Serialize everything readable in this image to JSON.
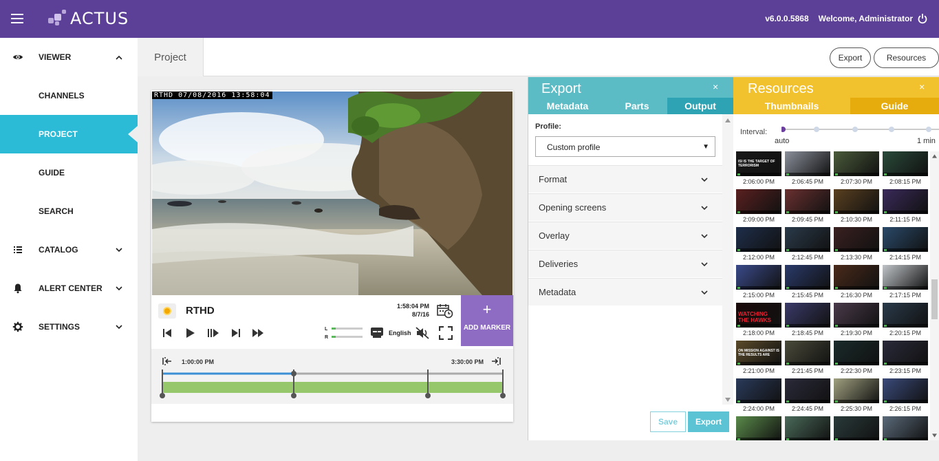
{
  "topbar": {
    "brand": "ACTUS",
    "version": "v6.0.0.5868",
    "welcome": "Welcome, Administrator"
  },
  "sidebar": {
    "items": [
      {
        "label": "VIEWER",
        "icon": "eye-icon",
        "chevron": "up"
      },
      {
        "label": "CHANNELS"
      },
      {
        "label": "PROJECT",
        "active": true
      },
      {
        "label": "GUIDE"
      },
      {
        "label": "SEARCH"
      },
      {
        "label": "CATALOG",
        "icon": "list-icon",
        "chevron": "down"
      },
      {
        "label": "ALERT CENTER",
        "icon": "bell-icon",
        "chevron": "down"
      },
      {
        "label": "SETTINGS",
        "icon": "gear-icon",
        "chevron": "down"
      }
    ]
  },
  "header": {
    "tab": "Project",
    "export_label": "Export",
    "resources_label": "Resources"
  },
  "player": {
    "osd": "RTHD 07/08/2016 13:58:04",
    "channel": "RTHD",
    "time": "1:58:04 PM",
    "date": "8/7/16",
    "language": "English",
    "add_marker_plus": "+",
    "add_marker": "ADD MARKER",
    "audio_left": "L",
    "audio_right": "R",
    "timeline_start": "1:00:00 PM",
    "timeline_end": "3:30:00 PM"
  },
  "export_panel": {
    "title": "Export",
    "close": "×",
    "tabs": [
      "Metadata",
      "Parts",
      "Output"
    ],
    "active_tab": "Output",
    "profile_label": "Profile:",
    "profile_value": "Custom profile",
    "sections": [
      "Format",
      "Opening screens",
      "Overlay",
      "Deliveries",
      "Metadata"
    ],
    "save_label": "Save",
    "export_label": "Export"
  },
  "resources_panel": {
    "title": "Resources",
    "close": "×",
    "tabs": [
      "Thumbnails",
      "Guide"
    ],
    "active_tab": "Thumbnails",
    "interval_label": "Interval:",
    "interval_min": "auto",
    "interval_max": "1 min",
    "thumbnail_times": [
      "2:06:00 PM",
      "2:06:45 PM",
      "2:07:30 PM",
      "2:08:15 PM",
      "2:09:00 PM",
      "2:09:45 PM",
      "2:10:30 PM",
      "2:11:15 PM",
      "2:12:00 PM",
      "2:12:45 PM",
      "2:13:30 PM",
      "2:14:15 PM",
      "2:15:00 PM",
      "2:15:45 PM",
      "2:16:30 PM",
      "2:17:15 PM",
      "2:18:00 PM",
      "2:18:45 PM",
      "2:19:30 PM",
      "2:20:15 PM",
      "2:21:00 PM",
      "2:21:45 PM",
      "2:22:30 PM",
      "2:23:15 PM",
      "2:24:00 PM",
      "2:24:45 PM",
      "2:25:30 PM",
      "2:26:15 PM"
    ],
    "thumbnail_colors": [
      "#181818",
      "#8a8f9a",
      "#4a5a3a",
      "#2a4a3a",
      "#5a2020",
      "#6a3030",
      "#5a4020",
      "#3a2a5a",
      "#1e2e4a",
      "#2a3a4a",
      "#3a2020",
      "#2a4a6a",
      "#3a4a8a",
      "#2a3a6a",
      "#4a2a1a",
      "#c0c4c8",
      "#1a0a0a",
      "#3a3a6a",
      "#4a3a4a",
      "#2a3a4a",
      "#5a4a2a",
      "#4a4a3a",
      "#1a2a2a",
      "#2a2a3a",
      "#2a3a5a",
      "#2a2a3a",
      "#a0a080",
      "#3a4a7a",
      "#5a8a4a",
      "#4a6a5a",
      "#2a3a3a",
      "#5a6a7a"
    ],
    "thumbnail_captions": {
      "0": "ISI IS THE TARGET OF TERRORISM",
      "16": "WATCHING THE HAWKS",
      "20": "ON MISSION AGAINST IS THE RESULTS ARE"
    }
  }
}
